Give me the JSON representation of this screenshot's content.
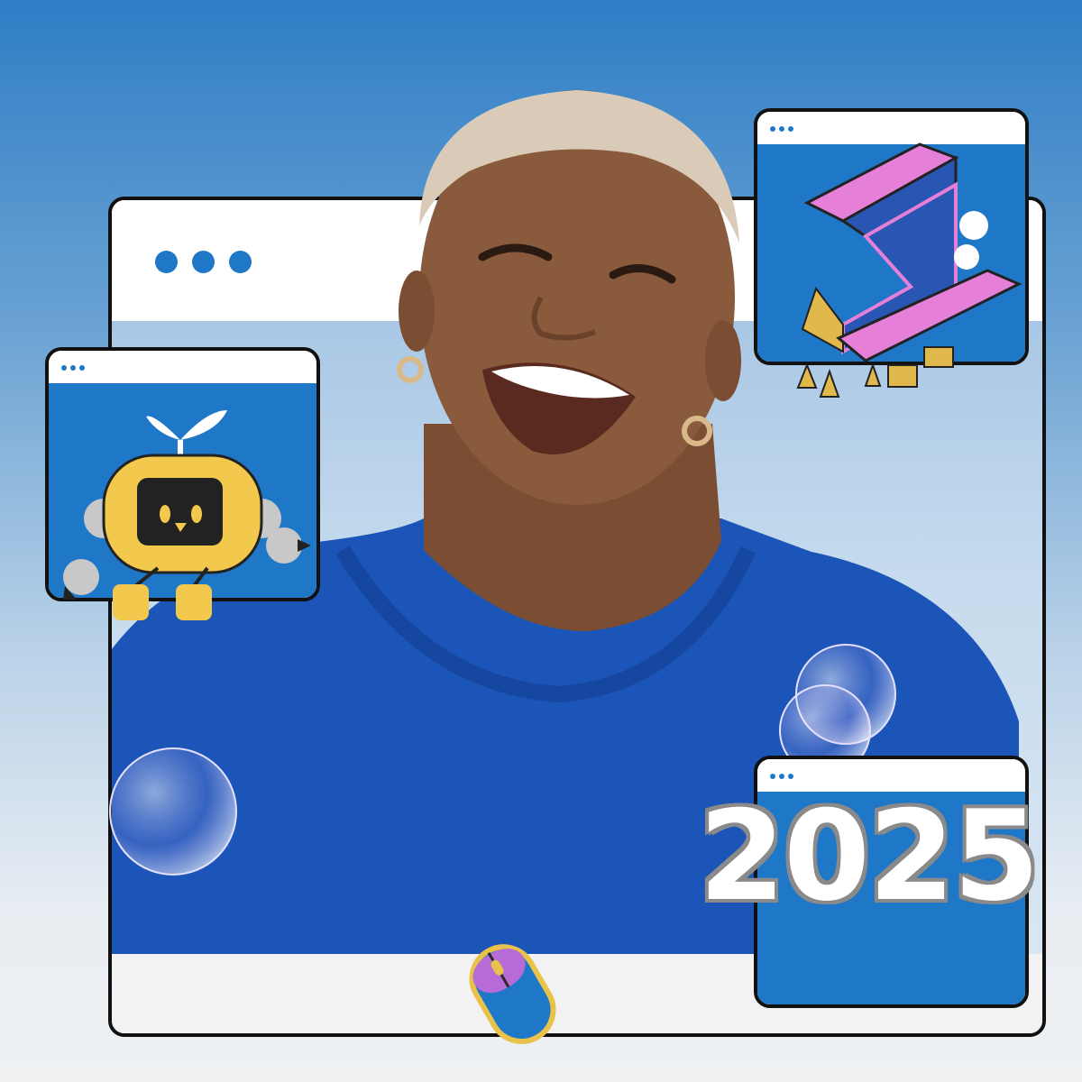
{
  "colors": {
    "accent": "#1f77c8",
    "sweater": "#1c55b8",
    "skin": "#8a5a3c",
    "robot_yellow": "#f2c94c",
    "z_pink": "#e67fd8",
    "outline": "#111111"
  },
  "icons": {
    "main_window_dots": "three-dots-icon",
    "mouse": "computer-mouse-icon",
    "robot": "robot-mascot",
    "z_letter": "isometric-z-illustration",
    "bubbles": "soap-bubble"
  },
  "badge": {
    "year": "2025"
  }
}
